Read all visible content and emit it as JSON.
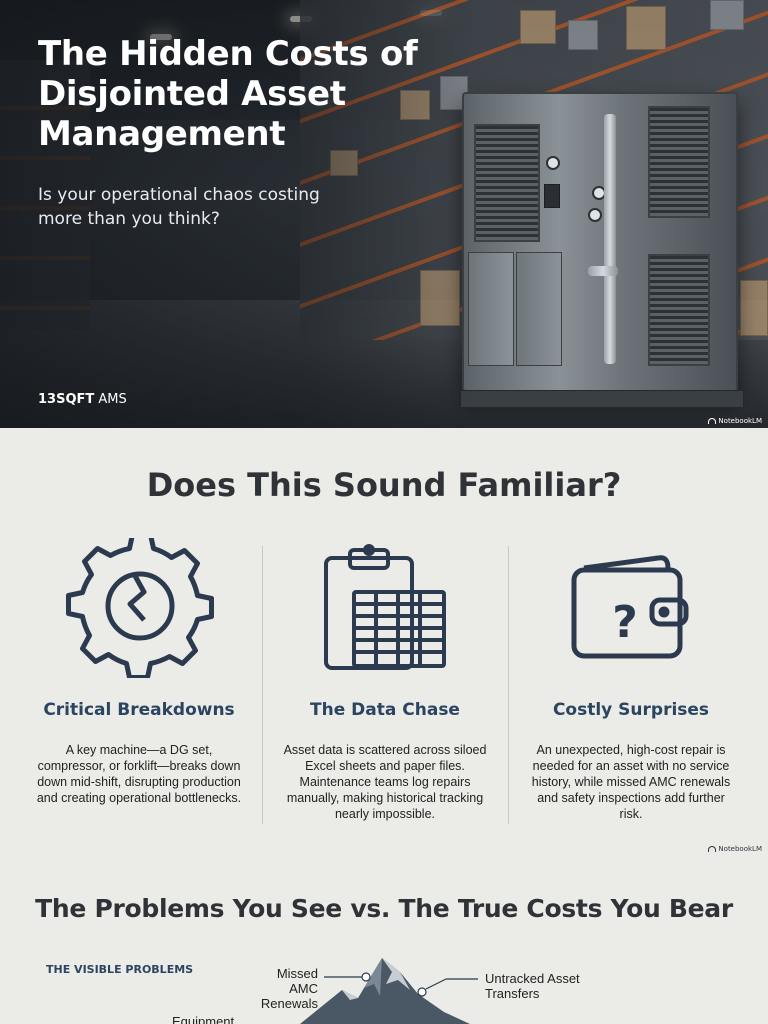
{
  "hero": {
    "title": "The Hidden Costs of Disjointed Asset Management",
    "subtitle": "Is your operational chaos costing more than you think?",
    "brand_bold": "13SQFT",
    "brand_rest": " AMS",
    "watermark": "NotebookLM"
  },
  "familiar": {
    "heading": "Does This Sound Familiar?",
    "columns": [
      {
        "icon": "broken-gear-icon",
        "title": "Critical Breakdowns",
        "text": "A key machine—a DG set, compressor, or forklift—breaks down down mid-shift, disrupting production and creating operational bottlenecks."
      },
      {
        "icon": "clipboard-spreadsheet-icon",
        "title": "The Data Chase",
        "text": "Asset data is scattered across siloed Excel sheets and paper files. Maintenance teams log repairs manually, making historical tracking nearly impossible."
      },
      {
        "icon": "wallet-question-icon",
        "title": "Costly Surprises",
        "text": "An unexpected, high-cost repair is needed for an asset with no service history, while missed AMC renewals and safety inspections add further risk."
      }
    ],
    "watermark": "NotebookLM",
    "icon_color": "#2b3a4e",
    "title_color": "#2b4561"
  },
  "costs": {
    "heading": "The Problems You See vs. The True Costs You Bear",
    "visible_label": "THE VISIBLE PROBLEMS",
    "iceberg_labels": [
      "Missed AMC Renewals",
      "Untracked Asset Transfers",
      "Equipment"
    ]
  }
}
